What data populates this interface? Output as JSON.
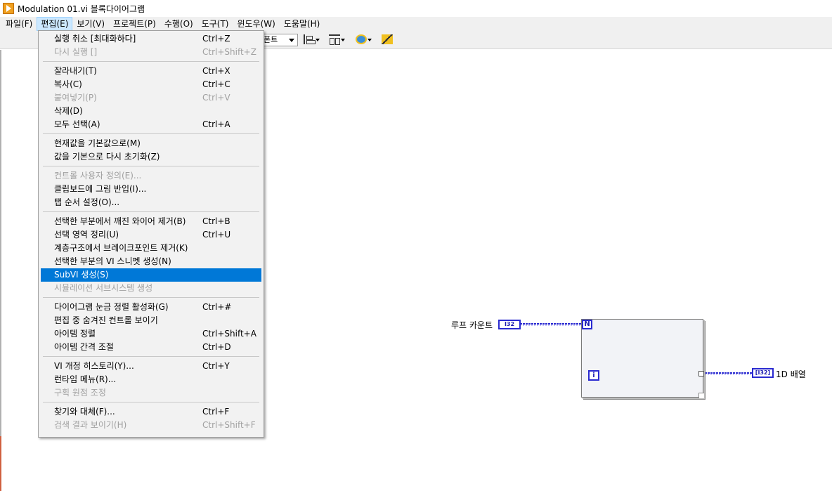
{
  "window": {
    "title": "Modulation 01.vi 블록다이어그램"
  },
  "menubar": {
    "items": [
      {
        "label": "파일(F)"
      },
      {
        "label": "편집(E)"
      },
      {
        "label": "보기(V)"
      },
      {
        "label": "프로젝트(P)"
      },
      {
        "label": "수행(O)"
      },
      {
        "label": "도구(T)"
      },
      {
        "label": "윈도우(W)"
      },
      {
        "label": "도움말(H)"
      }
    ]
  },
  "toolbar": {
    "font_label": "폰트",
    "icons": [
      "align-objects-icon",
      "distribute-objects-icon",
      "reorder-icon",
      "clean-up-diagram-icon"
    ]
  },
  "edit_menu": {
    "groups": [
      [
        {
          "label": "실행 취소 [최대화하다]",
          "shortcut": "Ctrl+Z",
          "enabled": true
        },
        {
          "label": "다시 실행 []",
          "shortcut": "Ctrl+Shift+Z",
          "enabled": false
        }
      ],
      [
        {
          "label": "잘라내기(T)",
          "shortcut": "Ctrl+X",
          "enabled": true
        },
        {
          "label": "복사(C)",
          "shortcut": "Ctrl+C",
          "enabled": true
        },
        {
          "label": "붙여넣기(P)",
          "shortcut": "Ctrl+V",
          "enabled": false
        },
        {
          "label": "삭제(D)",
          "shortcut": "",
          "enabled": true
        },
        {
          "label": "모두 선택(A)",
          "shortcut": "Ctrl+A",
          "enabled": true
        }
      ],
      [
        {
          "label": "현재값을 기본값으로(M)",
          "shortcut": "",
          "enabled": true
        },
        {
          "label": "값을 기본으로 다시 초기화(Z)",
          "shortcut": "",
          "enabled": true
        }
      ],
      [
        {
          "label": "컨트롤 사용자 정의(E)...",
          "shortcut": "",
          "enabled": false
        },
        {
          "label": "클립보드에 그림 반입(I)...",
          "shortcut": "",
          "enabled": true
        },
        {
          "label": "탭 순서 설정(O)...",
          "shortcut": "",
          "enabled": true
        }
      ],
      [
        {
          "label": "선택한 부분에서 깨진 와이어 제거(B)",
          "shortcut": "Ctrl+B",
          "enabled": true
        },
        {
          "label": "선택 영역 정리(U)",
          "shortcut": "Ctrl+U",
          "enabled": true
        },
        {
          "label": "계층구조에서 브레이크포인트 제거(K)",
          "shortcut": "",
          "enabled": true
        },
        {
          "label": "선택한 부분의 VI 스니펫 생성(N)",
          "shortcut": "",
          "enabled": true
        },
        {
          "label": "SubVI 생성(S)",
          "shortcut": "",
          "enabled": true,
          "highlighted": true
        },
        {
          "label": "시뮬레이션 서브시스템 생성",
          "shortcut": "",
          "enabled": false
        }
      ],
      [
        {
          "label": "다이어그램 눈금 정렬 활성화(G)",
          "shortcut": "Ctrl+#",
          "enabled": true
        },
        {
          "label": "편집 중 숨겨진 컨트롤 보이기",
          "shortcut": "",
          "enabled": true
        },
        {
          "label": "아이템 정렬",
          "shortcut": "Ctrl+Shift+A",
          "enabled": true
        },
        {
          "label": "아이템 간격 조절",
          "shortcut": "Ctrl+D",
          "enabled": true
        }
      ],
      [
        {
          "label": "VI 개정 히스토리(Y)...",
          "shortcut": "Ctrl+Y",
          "enabled": true
        },
        {
          "label": "런타임 메뉴(R)...",
          "shortcut": "",
          "enabled": true
        },
        {
          "label": "구획 원점 조정",
          "shortcut": "",
          "enabled": false
        }
      ],
      [
        {
          "label": "찾기와 대체(F)...",
          "shortcut": "Ctrl+F",
          "enabled": true
        },
        {
          "label": "검색 결과 보이기(H)",
          "shortcut": "Ctrl+Shift+F",
          "enabled": false
        }
      ]
    ]
  },
  "diagram": {
    "loop_count_label": "루프 카운트",
    "loop_count_terminal": "I32",
    "count_terminal": "N",
    "iteration_terminal": "i",
    "array_terminal": "[I32]",
    "array_label": "1D 배열",
    "wire_color": "#2a2ad0"
  }
}
